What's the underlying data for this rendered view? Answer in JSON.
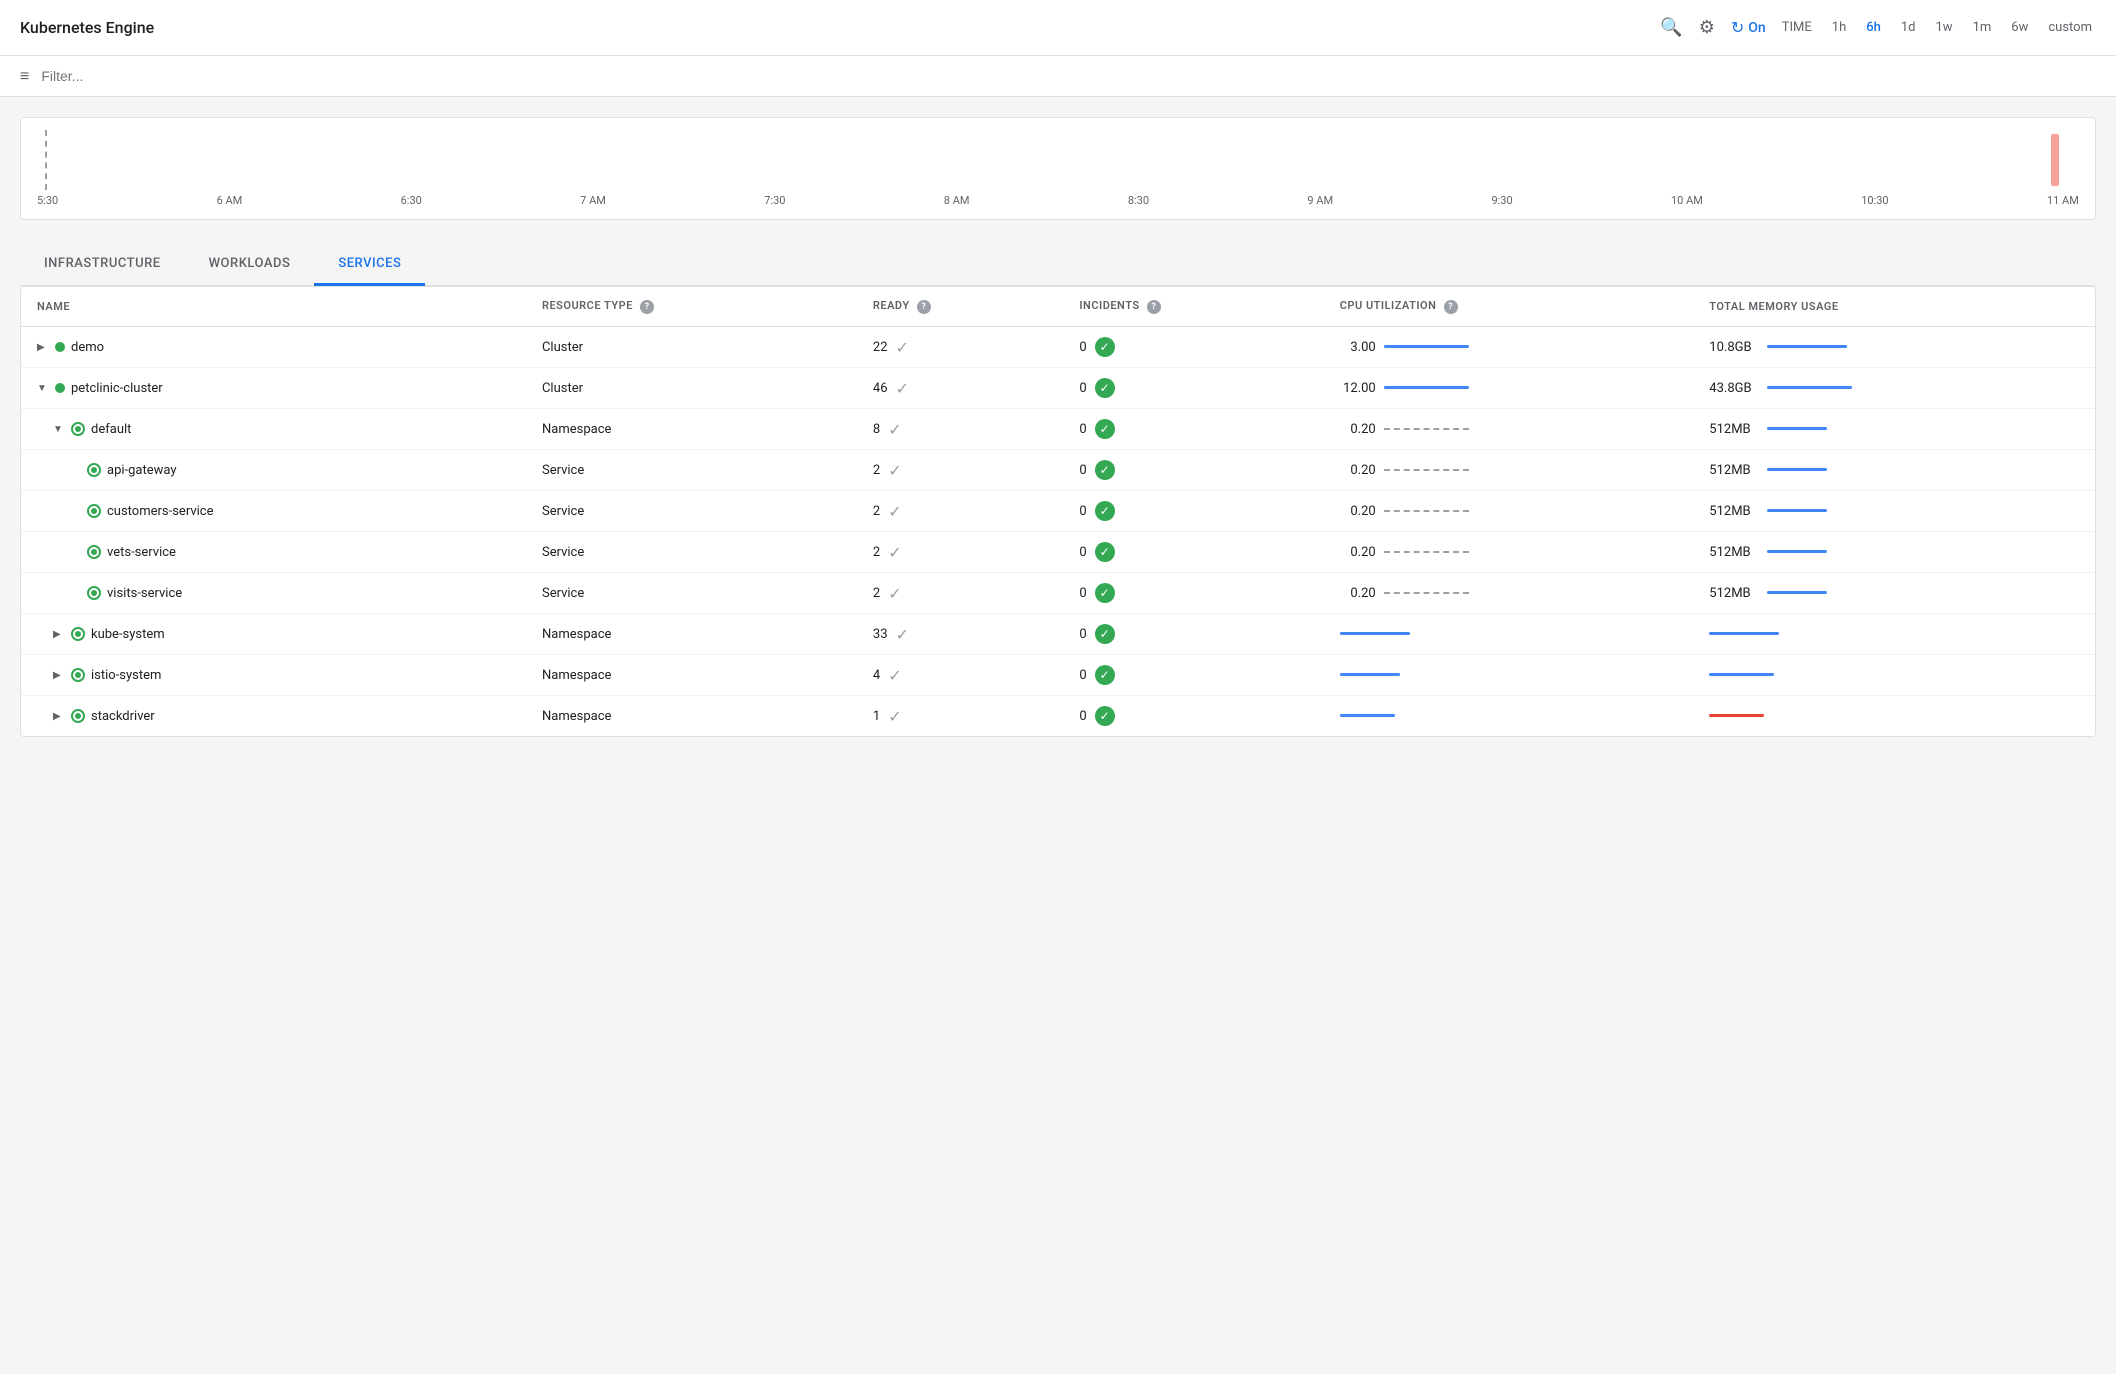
{
  "header": {
    "title": "Kubernetes Engine",
    "refresh_label": "On",
    "time_label": "TIME",
    "time_options": [
      "1h",
      "6h",
      "1d",
      "1w",
      "1m",
      "6w",
      "custom"
    ],
    "active_time": "6h"
  },
  "filter": {
    "placeholder": "Filter..."
  },
  "timeline": {
    "labels": [
      "5:30",
      "6 AM",
      "6:30",
      "7 AM",
      "7:30",
      "8 AM",
      "8:30",
      "9 AM",
      "9:30",
      "10 AM",
      "10:30",
      "11 AM"
    ]
  },
  "tabs": [
    {
      "label": "INFRASTRUCTURE",
      "active": false
    },
    {
      "label": "WORKLOADS",
      "active": false
    },
    {
      "label": "SERVICES",
      "active": true
    }
  ],
  "table": {
    "columns": [
      "NAME",
      "RESOURCE TYPE",
      "READY",
      "INCIDENTS",
      "CPU UTILIZATION",
      "TOTAL MEMORY USAGE"
    ],
    "rows": [
      {
        "name": "demo",
        "indent": 0,
        "expanded": false,
        "type": "Cluster",
        "ready": 22,
        "incidents": 0,
        "cpu": "3.00",
        "cpuBarType": "solid",
        "cpuBarWidth": 85,
        "memory": "10.8GB",
        "memBarWidth": 80,
        "memBarType": "solid",
        "statusType": "dot"
      },
      {
        "name": "petclinic-cluster",
        "indent": 0,
        "expanded": true,
        "type": "Cluster",
        "ready": 46,
        "incidents": 0,
        "cpu": "12.00",
        "cpuBarType": "solid",
        "cpuBarWidth": 85,
        "memory": "43.8GB",
        "memBarWidth": 85,
        "memBarType": "solid",
        "statusType": "dot"
      },
      {
        "name": "default",
        "indent": 1,
        "expanded": true,
        "type": "Namespace",
        "ready": 8,
        "incidents": 0,
        "cpu": "0.20",
        "cpuBarType": "dashed",
        "cpuBarWidth": 85,
        "memory": "512MB",
        "memBarWidth": 60,
        "memBarType": "solid",
        "statusType": "ring"
      },
      {
        "name": "api-gateway",
        "indent": 2,
        "expanded": false,
        "type": "Service",
        "ready": 2,
        "incidents": 0,
        "cpu": "0.20",
        "cpuBarType": "dashed",
        "cpuBarWidth": 85,
        "memory": "512MB",
        "memBarWidth": 60,
        "memBarType": "solid",
        "statusType": "ring"
      },
      {
        "name": "customers-service",
        "indent": 2,
        "expanded": false,
        "type": "Service",
        "ready": 2,
        "incidents": 0,
        "cpu": "0.20",
        "cpuBarType": "dashed",
        "cpuBarWidth": 85,
        "memory": "512MB",
        "memBarWidth": 60,
        "memBarType": "solid",
        "statusType": "ring"
      },
      {
        "name": "vets-service",
        "indent": 2,
        "expanded": false,
        "type": "Service",
        "ready": 2,
        "incidents": 0,
        "cpu": "0.20",
        "cpuBarType": "dashed",
        "cpuBarWidth": 85,
        "memory": "512MB",
        "memBarWidth": 60,
        "memBarType": "solid",
        "statusType": "ring"
      },
      {
        "name": "visits-service",
        "indent": 2,
        "expanded": false,
        "type": "Service",
        "ready": 2,
        "incidents": 0,
        "cpu": "0.20",
        "cpuBarType": "dashed",
        "cpuBarWidth": 85,
        "memory": "512MB",
        "memBarWidth": 60,
        "memBarType": "solid",
        "statusType": "ring"
      },
      {
        "name": "kube-system",
        "indent": 1,
        "expanded": false,
        "type": "Namespace",
        "ready": 33,
        "incidents": 0,
        "cpu": "",
        "cpuBarType": "solid",
        "cpuBarWidth": 70,
        "memory": "",
        "memBarWidth": 70,
        "memBarType": "solid",
        "statusType": "ring"
      },
      {
        "name": "istio-system",
        "indent": 1,
        "expanded": false,
        "type": "Namespace",
        "ready": 4,
        "incidents": 0,
        "cpu": "",
        "cpuBarType": "solid",
        "cpuBarWidth": 60,
        "memory": "",
        "memBarWidth": 65,
        "memBarType": "solid",
        "statusType": "ring"
      },
      {
        "name": "stackdriver",
        "indent": 1,
        "expanded": false,
        "type": "Namespace",
        "ready": 1,
        "incidents": 0,
        "cpu": "",
        "cpuBarType": "solid",
        "cpuBarWidth": 55,
        "memory": "",
        "memBarWidth": 55,
        "memBarType": "red",
        "statusType": "ring"
      }
    ]
  },
  "colors": {
    "accent": "#1a73e8",
    "green": "#34a853",
    "red": "#ea4335",
    "gray": "#5f6368",
    "light_gray": "#e8eaed",
    "blue_bar": "#4285f4"
  }
}
